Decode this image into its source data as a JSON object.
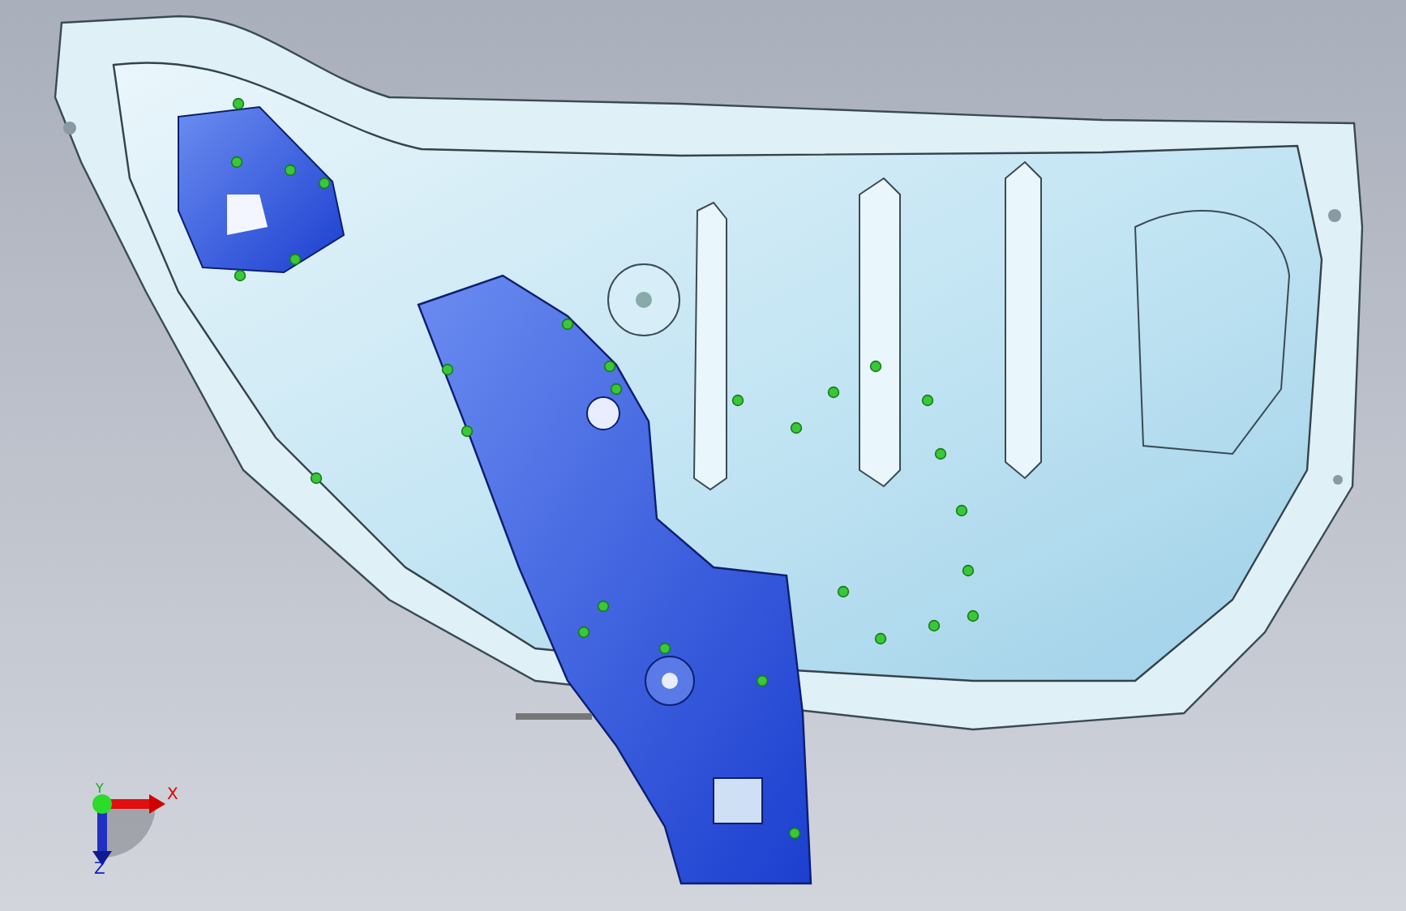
{
  "viewport": {
    "triad": {
      "axes": [
        {
          "label": "X",
          "kind": "x"
        },
        {
          "label": "Y",
          "kind": "y"
        },
        {
          "label": "Z",
          "kind": "z"
        }
      ]
    }
  }
}
